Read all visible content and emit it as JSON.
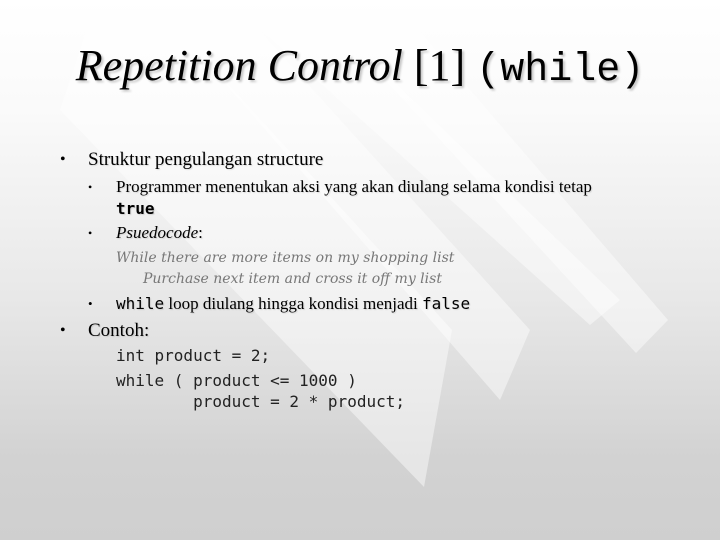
{
  "slide": {
    "title": {
      "italic": "Repetition Control",
      "plain": " [1] ",
      "mono": "(while)"
    },
    "bullets": [
      {
        "level": 1,
        "text": "Struktur pengulangan structure"
      },
      {
        "level": 2,
        "text": "Programmer menentukan aksi yang akan diulang selama kondisi tetap",
        "code_suffix": "true"
      },
      {
        "level": 2,
        "italic": "Psuedocode",
        "text": ":"
      },
      {
        "level": 2,
        "code_prefix": "while",
        "text": " loop diulang hingga kondisi menjadi ",
        "code_suffix": "false"
      },
      {
        "level": 1,
        "text": "Contoh:"
      }
    ],
    "pseudocode": [
      "While there are more items on my shopping list",
      "Purchase next item and cross it off my list"
    ],
    "code": [
      "int product = 2;",
      "while ( product <= 1000 )",
      "        product = 2 * product;"
    ],
    "bullet_glyph": "•"
  }
}
